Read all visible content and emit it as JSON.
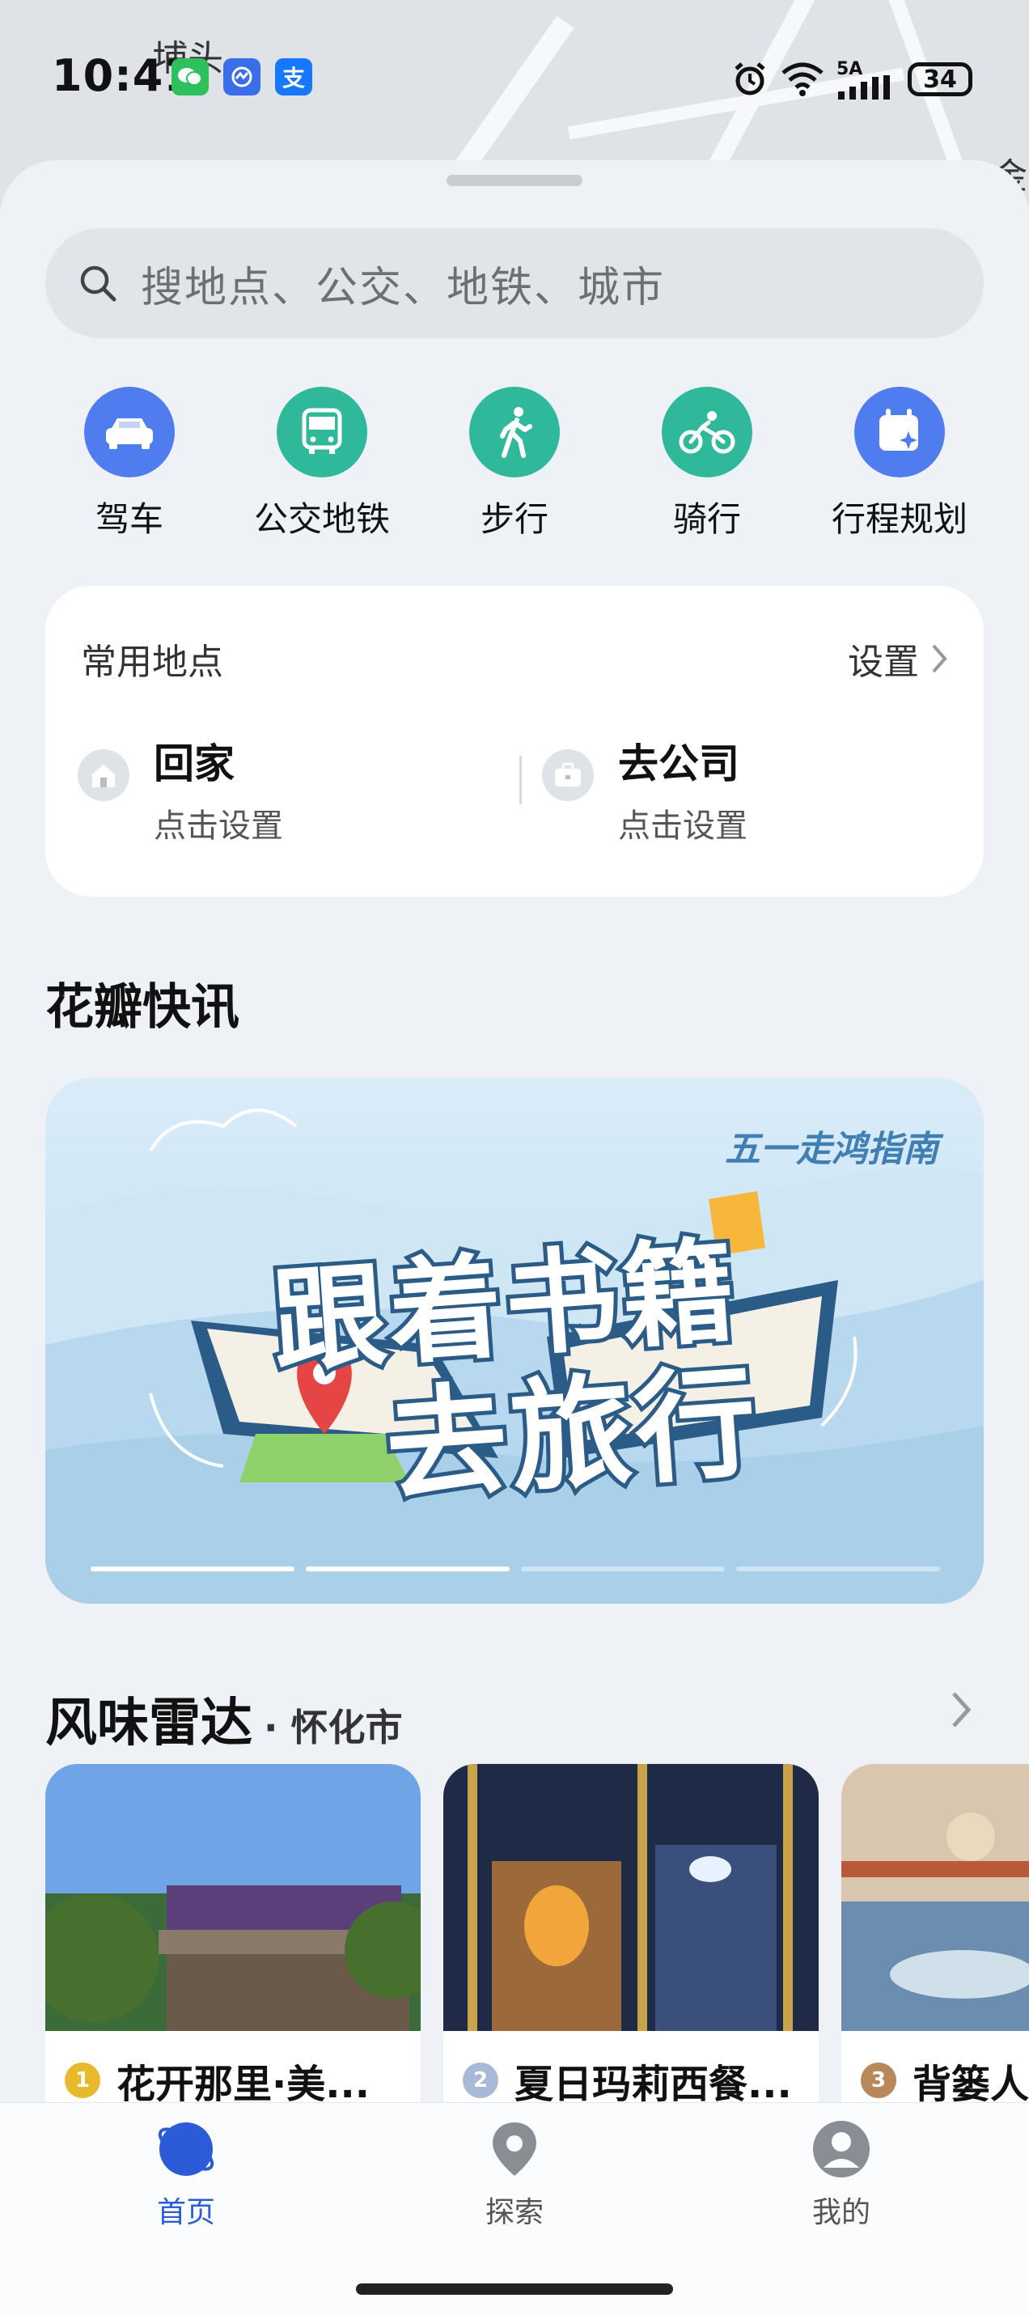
{
  "status_bar": {
    "time": "10:41",
    "battery": "34",
    "signal_label": "5A"
  },
  "map": {
    "label_top": "埔头",
    "label_right": "金"
  },
  "search": {
    "placeholder": "搜地点、公交、地铁、城市"
  },
  "tools": [
    {
      "label": "驾车",
      "icon": "car-icon",
      "color": "#4f7df0"
    },
    {
      "label": "公交地铁",
      "icon": "bus-icon",
      "color": "#2fb89a"
    },
    {
      "label": "步行",
      "icon": "walk-icon",
      "color": "#2fb89a"
    },
    {
      "label": "骑行",
      "icon": "bike-icon",
      "color": "#2fb89a"
    },
    {
      "label": "行程规划",
      "icon": "calendar-icon",
      "color": "#4f7df0"
    }
  ],
  "favorites": {
    "title": "常用地点",
    "settings": "设置",
    "home": {
      "name": "回家",
      "sub": "点击设置"
    },
    "work": {
      "name": "去公司",
      "sub": "点击设置"
    }
  },
  "news": {
    "title": "花瓣快讯",
    "banner_tag": "五一走鸿指南",
    "banner_line1": "跟着书籍",
    "banner_line2": "去旅行",
    "active_dot": 1,
    "dot_count": 4
  },
  "radar": {
    "title": "风味雷达",
    "city": "· 怀化市",
    "items": [
      {
        "rank": "1",
        "name": "花开那里·美...",
        "medal_color": "#e8b92a"
      },
      {
        "rank": "2",
        "name": "夏日玛莉西餐...",
        "medal_color": "#a9b8d6"
      },
      {
        "rank": "3",
        "name": "背篓人",
        "medal_color": "#b8875a"
      }
    ]
  },
  "tabbar": {
    "items": [
      {
        "label": "首页",
        "icon": "globe-icon",
        "active": true
      },
      {
        "label": "探索",
        "icon": "location-pin-icon",
        "active": false
      },
      {
        "label": "我的",
        "icon": "profile-icon",
        "active": false
      }
    ]
  }
}
